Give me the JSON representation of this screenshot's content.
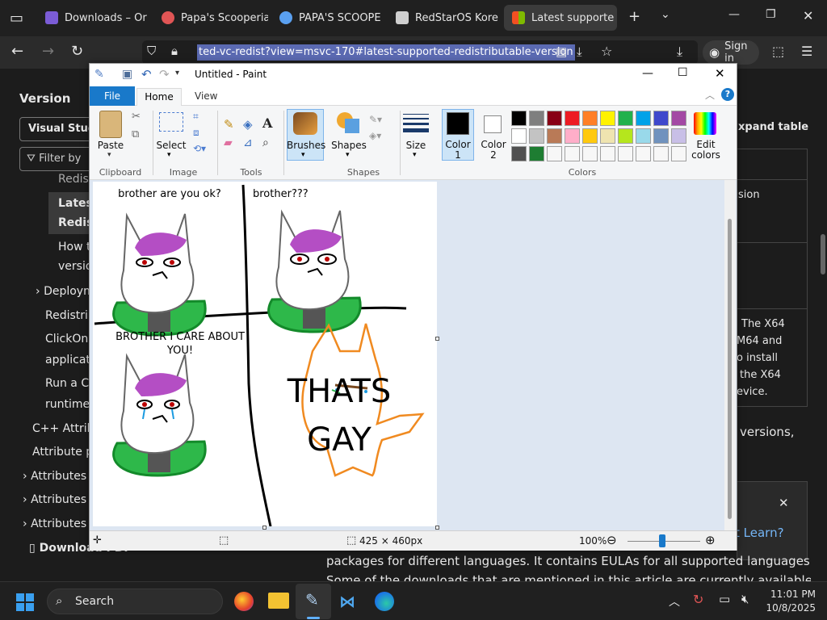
{
  "browser": {
    "tabs": [
      {
        "label": "Downloads – Or",
        "icon": "vs-icon",
        "color": "#7b5cd6"
      },
      {
        "label": "Papa's Scooperia",
        "icon": "game-icon",
        "color": "#e05555"
      },
      {
        "label": "PAPA'S SCOOPE",
        "icon": "globe-icon",
        "color": "#5aa0f0"
      },
      {
        "label": "RedStarOS Kore",
        "icon": "bank-icon",
        "color": "#cfcfcf"
      },
      {
        "label": "Latest supporte",
        "icon": "ms-icon",
        "color": "#f25022"
      }
    ],
    "url": "ted-vc-redist?view=msvc-170#latest-supported-redistributable-version",
    "sign_in": "Sign in"
  },
  "page": {
    "version_label": "Version",
    "version_select": "Visual Studi",
    "filter_placeholder": "Filter by",
    "nav": [
      "Redist",
      "Latest",
      "Redist",
      "How t",
      "versio",
      "Deploym",
      "Redistrib",
      "ClickOnc",
      "applicati",
      "Run a C+",
      "runtime",
      "C++ Attrib",
      "Attribute p",
      "Attributes b",
      "Attributes b",
      "Attributes a"
    ],
    "download_pdf": "Download PDF",
    "expand_table": "xpand table",
    "right_text": [
      "sion",
      "The X64",
      "M64 and",
      "o install",
      "the X64",
      "evice.",
      "versions,",
      "t Learn?"
    ],
    "bottom_text": [
      "packages for different languages. It contains EULAs for all supported languages.",
      "Some of the downloads that are mentioned in this article are currently available on"
    ]
  },
  "paint": {
    "title": "Untitled - Paint",
    "menu": {
      "file": "File",
      "home": "Home",
      "view": "View"
    },
    "groups": {
      "clipboard": "Clipboard",
      "image": "Image",
      "tools": "Tools",
      "shapes": "Shapes",
      "colors": "Colors"
    },
    "buttons": {
      "paste": "Paste",
      "select": "Select",
      "brushes": "Brushes",
      "shapes": "Shapes",
      "size": "Size",
      "color1": "Color",
      "color1_num": "1",
      "color2": "Color",
      "color2_num": "2",
      "edit": "Edit",
      "edit2": "colors"
    },
    "palette": [
      "#000000",
      "#7f7f7f",
      "#880015",
      "#ed1c24",
      "#ff7f27",
      "#fff200",
      "#22b14c",
      "#00a2e8",
      "#3f48cc",
      "#a349a4",
      "#ffffff",
      "#c3c3c3",
      "#b97a57",
      "#ffaec9",
      "#ffc90e",
      "#efe4b0",
      "#b5e61d",
      "#99d9ea",
      "#7092be",
      "#c8bfe7",
      "#505050",
      "#1e7d32",
      "#f7f7f7",
      "#f7f7f7",
      "#f7f7f7",
      "#f7f7f7",
      "#f7f7f7",
      "#f7f7f7",
      "#f7f7f7",
      "#f7f7f7"
    ],
    "comic": {
      "panel1": "brother are you ok?",
      "panel2": "brother???",
      "panel3a": "BROTHER I CARE ABOUT",
      "panel3b": "YOU!",
      "panel4a": "THATS",
      "panel4b": "GAY"
    },
    "status": {
      "dimensions": "425 × 460px",
      "zoom": "100%"
    }
  },
  "taskbar": {
    "search": "Search",
    "time": "11:01 PM",
    "date": "10/8/2025"
  }
}
